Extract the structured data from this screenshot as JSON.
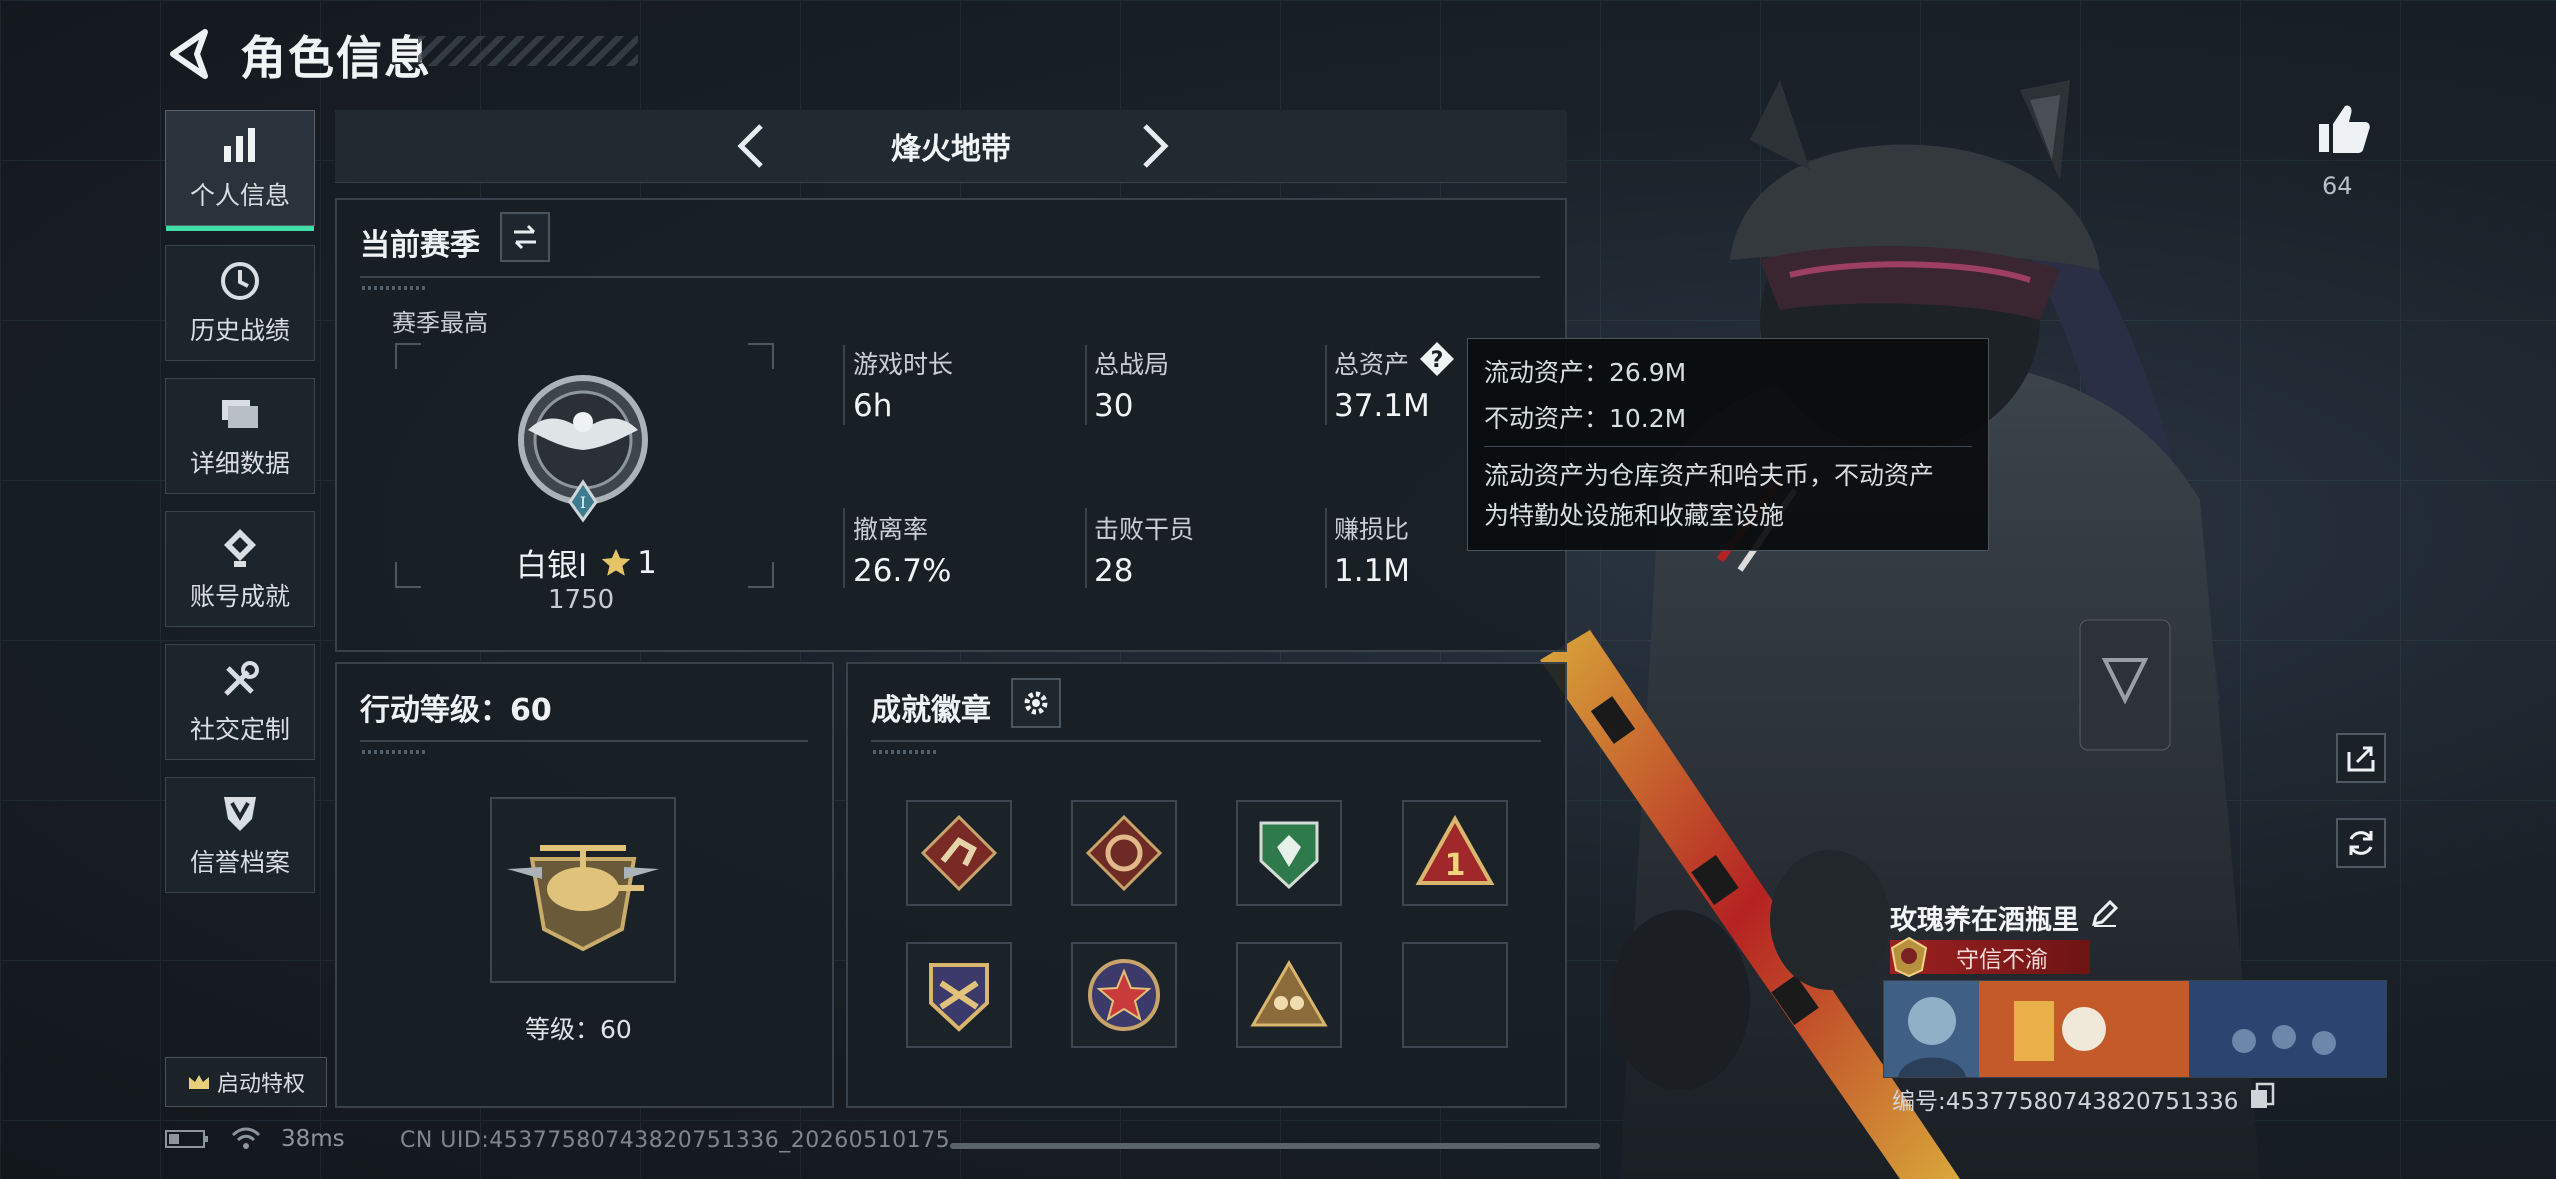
{
  "header": {
    "title": "角色信息"
  },
  "sidebar": {
    "items": [
      {
        "label": "个人信息",
        "icon": "bar-chart-icon",
        "active": true
      },
      {
        "label": "历史战绩",
        "icon": "clock-icon"
      },
      {
        "label": "详细数据",
        "icon": "folder-icon"
      },
      {
        "label": "账号成就",
        "icon": "medal-icon"
      },
      {
        "label": "社交定制",
        "icon": "tools-icon"
      },
      {
        "label": "信誉档案",
        "icon": "shield-icon"
      }
    ],
    "privilege_label": "启动特权"
  },
  "mode": {
    "title": "烽火地带"
  },
  "season": {
    "title": "当前赛季",
    "best_label": "赛季最高",
    "rank_name": "白银I",
    "rank_stars": "1",
    "rank_score": "1750"
  },
  "stats": [
    {
      "label": "游戏时长",
      "value": "6h"
    },
    {
      "label": "总战局",
      "value": "30"
    },
    {
      "label": "总资产",
      "value": "37.1M"
    },
    {
      "label": "撤离率",
      "value": "26.7%"
    },
    {
      "label": "击败干员",
      "value": "28"
    },
    {
      "label": "赚损比",
      "value": "1.1M"
    }
  ],
  "tooltip": {
    "liquid": "流动资产：26.9M",
    "fixed": "不动资产：10.2M",
    "desc1": "流动资产为仓库资产和哈夫币，不动资产",
    "desc2": "为特勤处设施和收藏室设施"
  },
  "action_level": {
    "title": "行动等级：60",
    "level_label": "等级：60"
  },
  "achievements": {
    "title": "成就徽章"
  },
  "status": {
    "ping": "38ms",
    "uid": "CN UID:4537758074382075133​6_2026051017​5"
  },
  "right": {
    "likes": "64",
    "player_name": "玫瑰养在酒瓶里",
    "tag": "守信不渝",
    "player_id": "编号:4537758074382075133​6"
  },
  "colors": {
    "accent": "#3fe0a6",
    "tag_red": "#9c2121"
  }
}
